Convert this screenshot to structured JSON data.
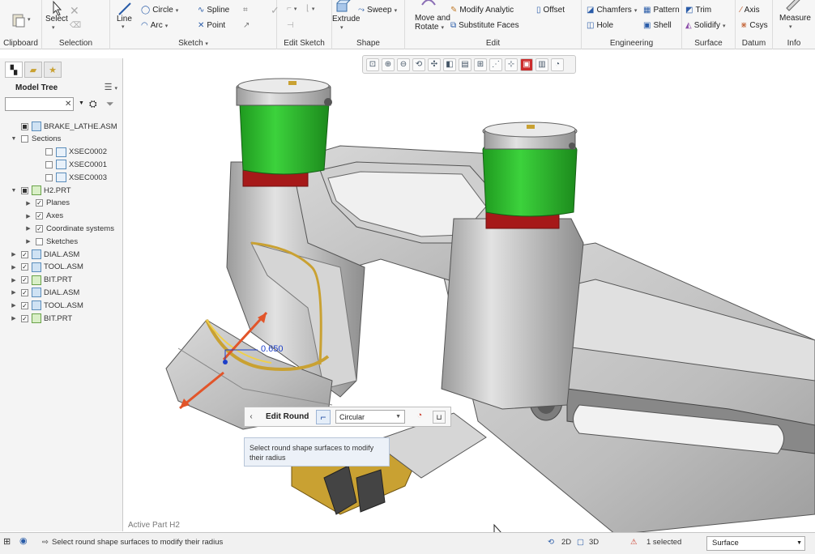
{
  "ribbon": {
    "clipboard_label": "Clipboard",
    "selection_label": "Selection",
    "select_label": "Select",
    "sketch_label": "Sketch",
    "line_label": "Line",
    "circle_label": "Circle",
    "arc_label": "Arc",
    "spline_label": "Spline",
    "point_label": "Point",
    "edit_sketch_label": "Edit Sketch",
    "shape_label": "Shape",
    "extrude_label": "Extrude",
    "sweep_label": "Sweep",
    "edit_label": "Edit",
    "move_rotate_label_1": "Move and",
    "move_rotate_label_2": "Rotate",
    "modify_analytic_label": "Modify Analytic",
    "substitute_faces_label": "Substitute Faces",
    "offset_label": "Offset",
    "engineering_label": "Engineering",
    "chamfers_label": "Chamfers",
    "hole_label": "Hole",
    "pattern_label": "Pattern",
    "shell_label": "Shell",
    "surface_label": "Surface",
    "trim_label": "Trim",
    "solidify_label": "Solidify",
    "datum_label": "Datum",
    "axis_label": "Axis",
    "csys_label": "Csys",
    "info_label": "Info",
    "measure_label": "Measure"
  },
  "model_tree": {
    "title": "Model Tree",
    "filter_value": "",
    "items": [
      {
        "label": "BRAKE_LATHE.ASM",
        "expander": "",
        "checkbox": "partial",
        "icon": "assembly"
      },
      {
        "label": "Sections",
        "expander": "▼",
        "checkbox": "empty",
        "icon": "none"
      },
      {
        "label": "XSEC0002",
        "expander": "",
        "checkbox": "empty",
        "icon": "section"
      },
      {
        "label": "XSEC0001",
        "expander": "",
        "checkbox": "empty",
        "icon": "section"
      },
      {
        "label": "XSEC0003",
        "expander": "",
        "checkbox": "empty",
        "icon": "section"
      },
      {
        "label": "H2.PRT",
        "expander": "▼",
        "checkbox": "partial",
        "icon": "part"
      },
      {
        "label": "Planes",
        "expander": "▶",
        "checkbox": "checked",
        "icon": "none"
      },
      {
        "label": "Axes",
        "expander": "▶",
        "checkbox": "checked",
        "icon": "none"
      },
      {
        "label": "Coordinate systems",
        "expander": "▶",
        "checkbox": "checked",
        "icon": "none"
      },
      {
        "label": "Sketches",
        "expander": "▶",
        "checkbox": "empty",
        "icon": "none"
      },
      {
        "label": "DIAL.ASM",
        "expander": "▶",
        "checkbox": "checked",
        "icon": "assembly"
      },
      {
        "label": "TOOL.ASM",
        "expander": "▶",
        "checkbox": "checked",
        "icon": "assembly"
      },
      {
        "label": "BIT.PRT",
        "expander": "▶",
        "checkbox": "checked",
        "icon": "part"
      },
      {
        "label": "DIAL.ASM",
        "expander": "▶",
        "checkbox": "checked",
        "icon": "assembly"
      },
      {
        "label": "TOOL.ASM",
        "expander": "▶",
        "checkbox": "checked",
        "icon": "assembly"
      },
      {
        "label": "BIT.PRT",
        "expander": "▶",
        "checkbox": "checked",
        "icon": "part"
      }
    ]
  },
  "viewport": {
    "dimension_value": "0.650",
    "active_part": "Active Part H2"
  },
  "mini_toolbar": {
    "title": "Edit Round",
    "shape_select": "Circular",
    "tooltip": "Select round shape surfaces to modify their radius"
  },
  "status": {
    "message": "Select round shape surfaces to modify their radius",
    "mode_2d": "2D",
    "mode_3d": "3D",
    "selected_count": "1 selected",
    "filter_value": "Surface"
  },
  "colors": {
    "accent_green": "#2fc02f",
    "accent_red": "#b01818",
    "dimension_blue": "#1d3fc8",
    "arrow_orange": "#e2552a"
  }
}
